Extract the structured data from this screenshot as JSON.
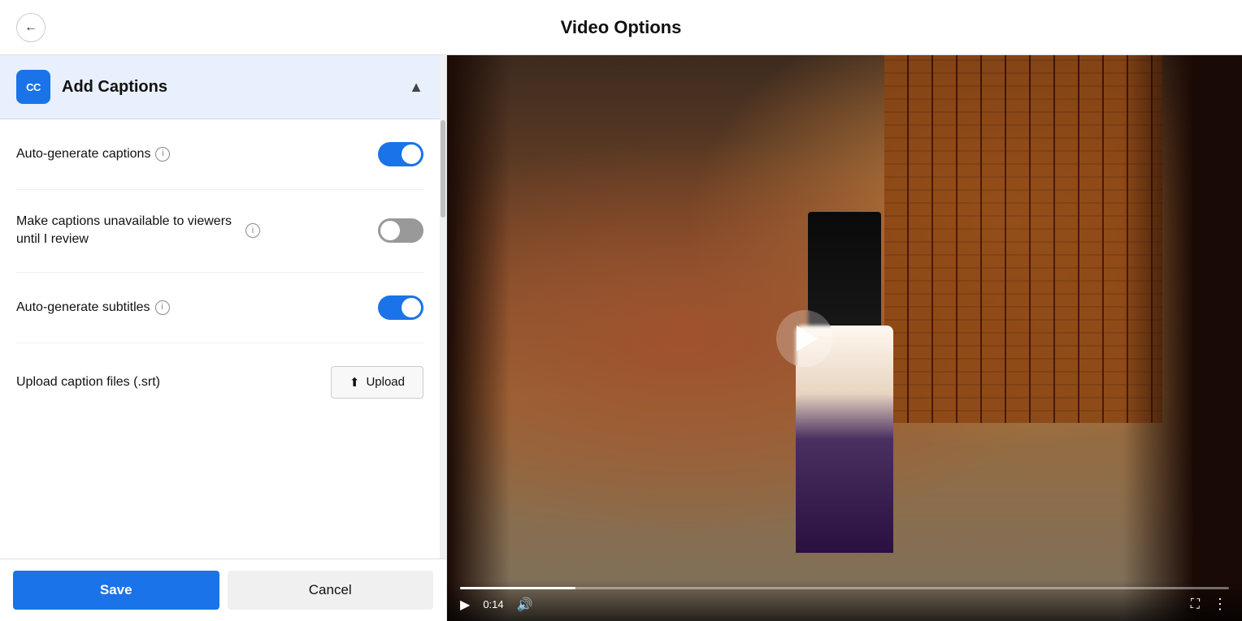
{
  "header": {
    "title": "Video Options",
    "back_label": "←"
  },
  "left_panel": {
    "section": {
      "title": "Add Captions",
      "cc_label": "CC",
      "collapse_icon": "▲"
    },
    "options": [
      {
        "id": "auto-generate-captions",
        "label": "Auto-generate captions",
        "has_info": true,
        "enabled": true
      },
      {
        "id": "make-captions-unavailable",
        "label": "Make captions unavailable to viewers until I review",
        "has_info": true,
        "enabled": false
      },
      {
        "id": "auto-generate-subtitles",
        "label": "Auto-generate subtitles",
        "has_info": true,
        "enabled": true
      },
      {
        "id": "upload-caption-files",
        "label": "Upload caption files (.srt)",
        "has_info": false,
        "is_upload": true
      }
    ],
    "upload_button_label": "Upload",
    "save_label": "Save",
    "cancel_label": "Cancel"
  },
  "video": {
    "time": "0:14",
    "play_icon": "▶",
    "volume_icon": "🔊",
    "fullscreen_icon": "⛶",
    "more_icon": "⋮"
  }
}
